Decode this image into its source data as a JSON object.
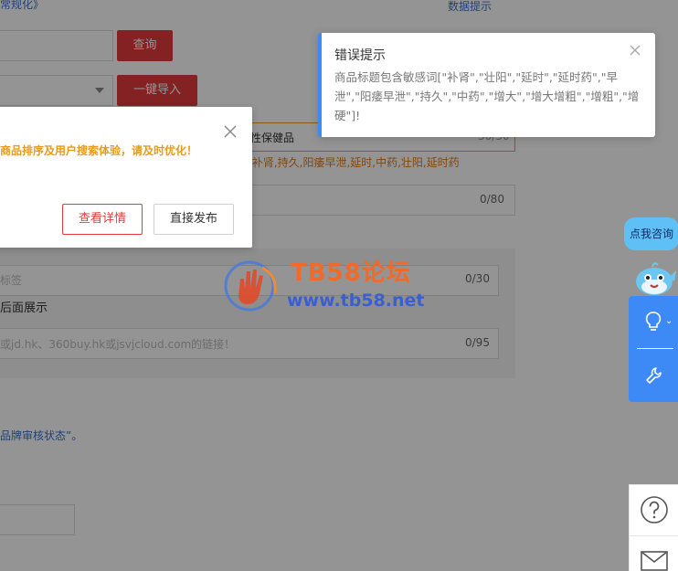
{
  "background": {
    "top_link": "常规化》",
    "top_right_link": "数据提示",
    "query_button": "查询",
    "import_button": "一键导入",
    "title_text": "男性保健品",
    "title_count": "30/30",
    "sensitive_words": "肚,补肾,持久,阳痿早泄,延时,中药,壮阳,延时药",
    "subtitle_count": "0/80",
    "tag_placeholder": "标签",
    "tag_count": "0/30",
    "back_show": "后面展示",
    "link_placeholder": "或jd.hk、360buy.hk或jsvjcloud.com的链接！",
    "link_count": "0/95",
    "brand_note": "品牌审核状态”。"
  },
  "modal": {
    "message": "商品排序及用户搜索体验，请及时优化！",
    "detail_button": "查看详情",
    "publish_button": "直接发布"
  },
  "notification": {
    "title": "错误提示",
    "body": "商品标题包含敏感词[\"补肾\",\"壮阳\",\"延时\",\"延时药\",\"早泄\",\"阳痿早泄\",\"持久\",\"中药\",\"增大\",\"增大增粗\",\"增粗\",\"增硬\"]!"
  },
  "watermark": {
    "title": "TB58论坛",
    "url": "www.tb58.net"
  },
  "side": {
    "consult_label": "点我咨询",
    "bulb_caret": "⌄"
  },
  "colors": {
    "accent_blue": "#3d8af7",
    "brand_red": "#e4393c",
    "warning_orange": "#e89a1a"
  }
}
